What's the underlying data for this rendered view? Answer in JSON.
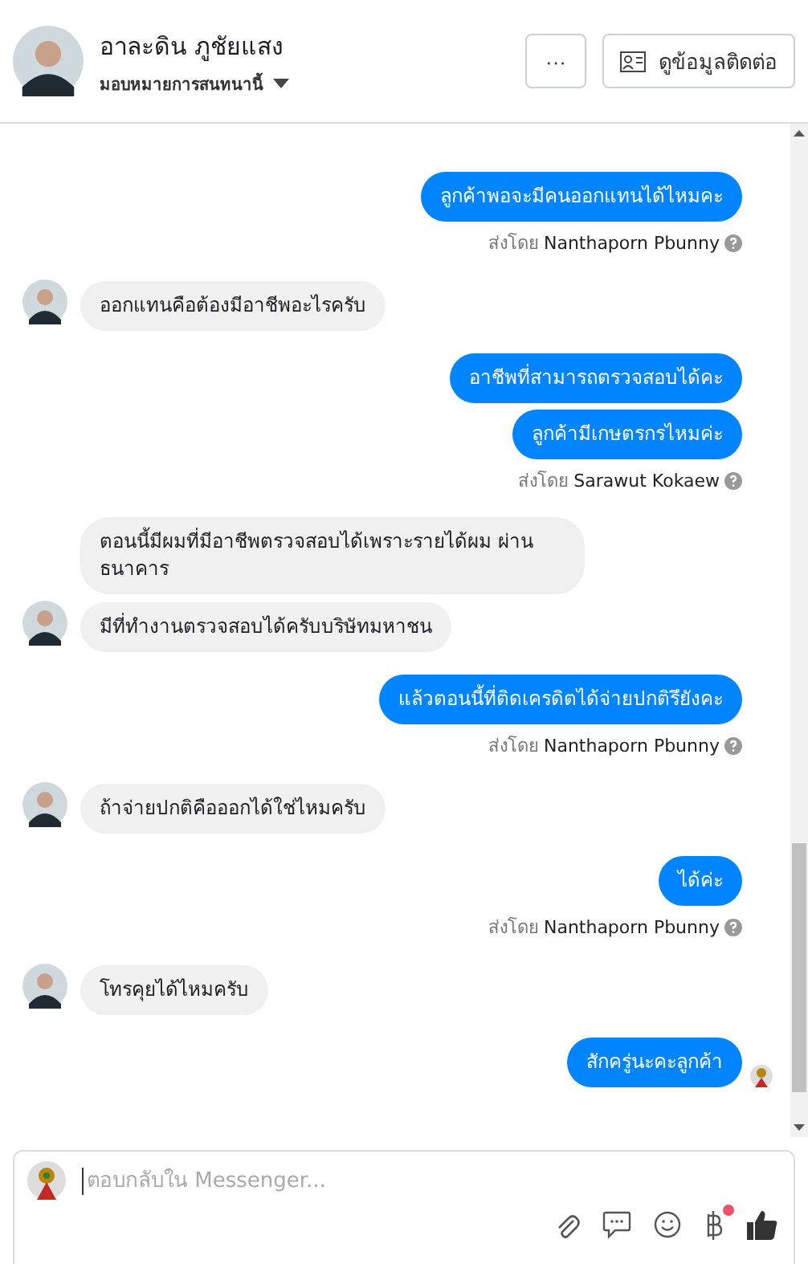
{
  "header": {
    "name": "อาละดิน ภูชัยแสง",
    "assign": "มอบหมายการสนทนานี้",
    "more_button": "···",
    "contact_button": "ดูข้อมูลติดต่อ"
  },
  "messages": [
    {
      "kind": "out",
      "text": "ลูกค้าพอจะมีคนออกแทนได้ไหมคะ"
    },
    {
      "kind": "sender",
      "label": "ส่งโดย",
      "name": "Nanthaporn Pbunny"
    },
    {
      "kind": "in",
      "text": "ออกแทนคือต้องมีอาชีพอะไรครับ",
      "avatar": true
    },
    {
      "kind": "out",
      "text": "อาชีพที่สามารถตรวจสอบได้คะ"
    },
    {
      "kind": "out",
      "text": "ลูกค้ามีเกษตรกรไหมค่ะ"
    },
    {
      "kind": "sender",
      "label": "ส่งโดย",
      "name": "Sarawut Kokaew"
    },
    {
      "kind": "in",
      "text": "ตอนนี้มีผมที่มีอาชีพตรวจสอบได้เพราะรายได้ผม ผ่านธนาคาร",
      "avatar": false
    },
    {
      "kind": "in",
      "text": "มีที่ทำงานตรวจสอบได้ครับบริษัทมหาชน",
      "avatar": true
    },
    {
      "kind": "out",
      "text": "แล้วตอนนี้ที่ติดเครดิตได้จ่ายปกติรึยังคะ"
    },
    {
      "kind": "sender",
      "label": "ส่งโดย",
      "name": "Nanthaporn Pbunny"
    },
    {
      "kind": "in",
      "text": "ถ้าจ่ายปกติคือออกได้ใช่ไหมครับ",
      "avatar": true
    },
    {
      "kind": "out",
      "text": "ได้ค่ะ"
    },
    {
      "kind": "sender",
      "label": "ส่งโดย",
      "name": "Nanthaporn Pbunny"
    },
    {
      "kind": "in",
      "text": "โทรคุยได้ไหมครับ",
      "avatar": true
    },
    {
      "kind": "out",
      "text": "สักครู่นะคะลูกค้า",
      "seen": true
    }
  ],
  "composer": {
    "placeholder": "ตอบกลับใน Messenger...",
    "payment_badge": true
  }
}
